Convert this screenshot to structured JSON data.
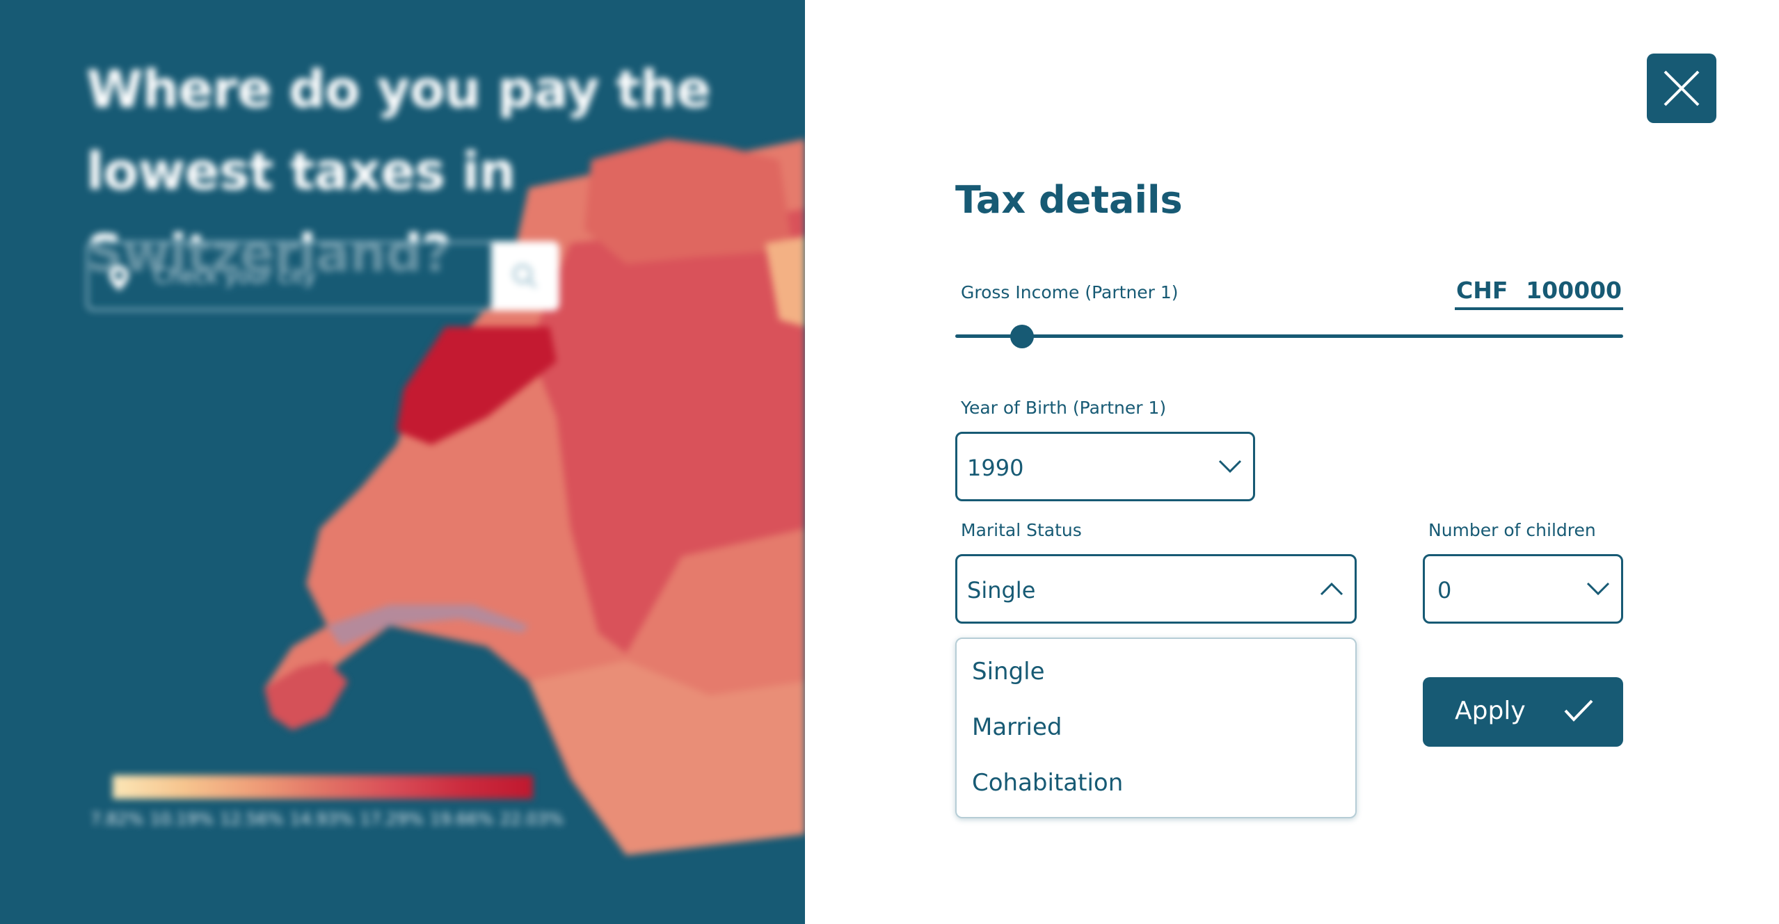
{
  "background": {
    "title": "Where do you pay the lowest taxes in Switzerland?",
    "search": {
      "placeholder": "Check your city",
      "pin_icon": "map-pin-icon",
      "button_icon": "search-icon"
    },
    "legend": {
      "labels": [
        "7.82%",
        "10.19%",
        "12.56%",
        "14.93%",
        "17.29%",
        "19.66%",
        "22.03%"
      ],
      "colors": [
        "#fbe6b6",
        "#f6c58f",
        "#ef9f79",
        "#e27466",
        "#d94d57",
        "#cb2b3e",
        "#c0182f"
      ]
    }
  },
  "panel": {
    "close_icon": "close-icon",
    "title": "Tax details",
    "income": {
      "label": "Gross Income (Partner 1)",
      "currency": "CHF",
      "value": "100000",
      "slider_fraction": 0.1
    },
    "birth_year": {
      "label": "Year of Birth (Partner 1)",
      "value": "1990"
    },
    "marital_status": {
      "label": "Marital Status",
      "value": "Single",
      "options": [
        "Single",
        "Married",
        "Cohabitation"
      ]
    },
    "children": {
      "label": "Number of children",
      "value": "0"
    },
    "apply": {
      "label": "Apply",
      "icon": "check-icon"
    }
  },
  "colors": {
    "primary": "#175a74",
    "white": "#ffffff"
  }
}
